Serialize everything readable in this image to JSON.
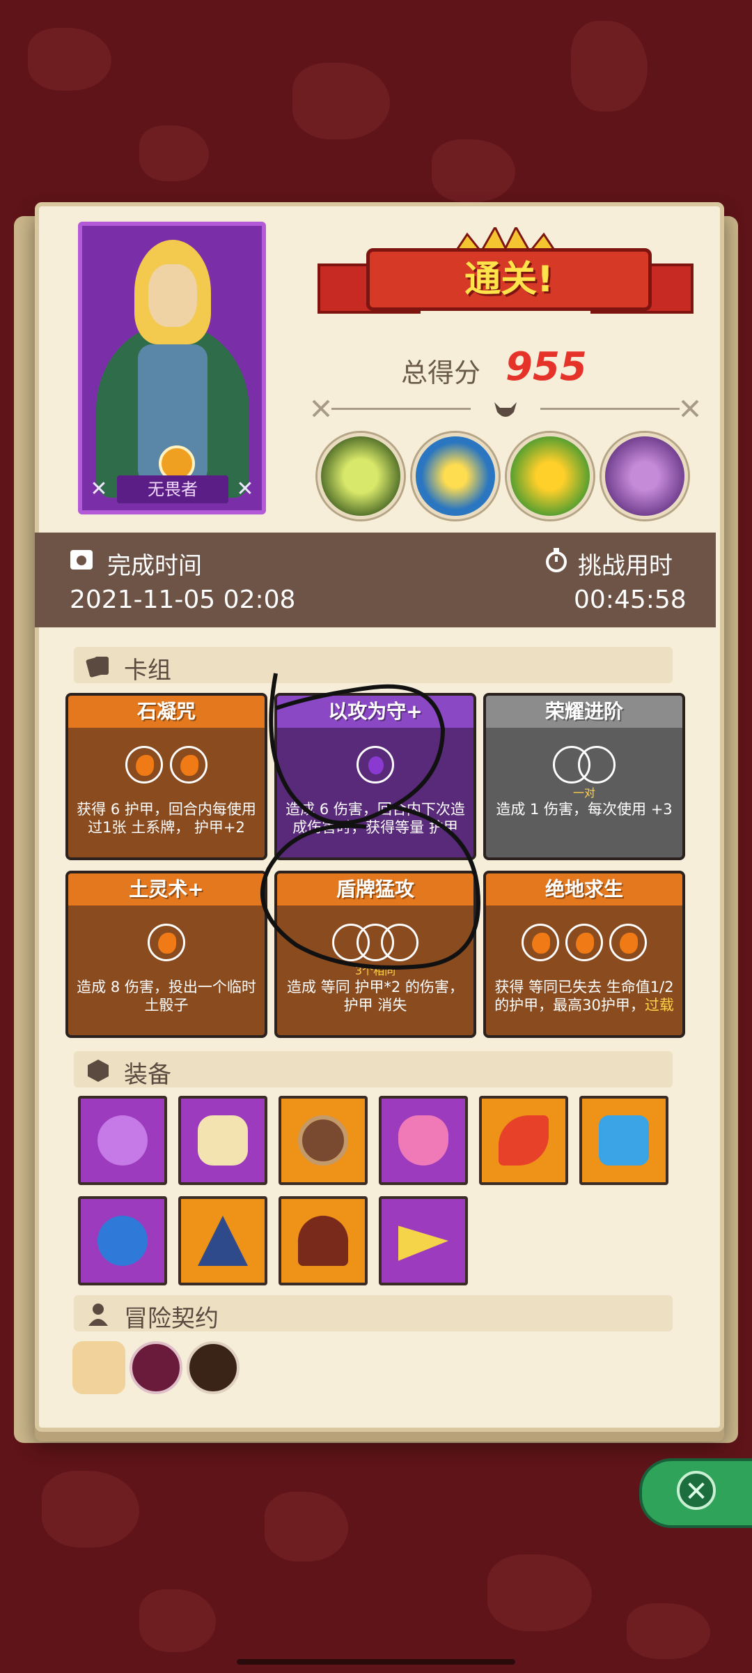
{
  "hero": {
    "name": "无畏者"
  },
  "banner": {
    "title": "通关!"
  },
  "score": {
    "label": "总得分",
    "value": "955"
  },
  "info": {
    "completion_label": "完成时间",
    "completion_value": "2021-11-05 02:08",
    "duration_label": "挑战用时",
    "duration_value": "00:45:58"
  },
  "sections": {
    "deck": "卡组",
    "equipment": "装备",
    "contract": "冒险契约"
  },
  "cards": [
    {
      "title": "石凝咒",
      "desc": "获得 6 护甲，回合内每使用过1张 土系牌， 护甲+2",
      "sub": ""
    },
    {
      "title": "以攻为守+",
      "desc": "造成 6 伤害，回合内下次造成伤害时，获得等量 护甲",
      "sub": ""
    },
    {
      "title": "荣耀进阶",
      "desc": "造成 1 伤害，每次使用 +3",
      "sub": "一对"
    },
    {
      "title": "土灵术+",
      "desc": "造成 8 伤害，投出一个临时土骰子",
      "sub": ""
    },
    {
      "title": "盾牌猛攻",
      "desc": "造成 等同 护甲*2 的伤害， 护甲 消失",
      "sub": "3个相同"
    },
    {
      "title": "绝地求生",
      "desc": "获得 等同已失去 生命值1/2 的护甲，最高30护甲，",
      "highlight": "过载",
      "sub": ""
    }
  ],
  "equipment": [
    {
      "icon": "potion-icon",
      "rarity": "purple"
    },
    {
      "icon": "claws-icon",
      "rarity": "purple"
    },
    {
      "icon": "ring-plate-icon",
      "rarity": "orange"
    },
    {
      "icon": "heart-amulet-icon",
      "rarity": "purple"
    },
    {
      "icon": "feather-icon",
      "rarity": "orange"
    },
    {
      "icon": "crystal-shield-icon",
      "rarity": "orange"
    },
    {
      "icon": "blue-flame-icon",
      "rarity": "purple"
    },
    {
      "icon": "hexagram-icon",
      "rarity": "orange"
    },
    {
      "icon": "hood-icon",
      "rarity": "orange"
    },
    {
      "icon": "cheese-icon",
      "rarity": "purple"
    }
  ],
  "contracts": [
    {
      "icon": "scroll-icon"
    },
    {
      "icon": "dice-icon"
    },
    {
      "icon": "pipe-icon"
    }
  ],
  "bosses": [
    {
      "icon": "dino-skull-icon"
    },
    {
      "icon": "crowned-beetle-icon"
    },
    {
      "icon": "goblin-king-icon"
    },
    {
      "icon": "purple-dragon-icon"
    }
  ],
  "colors": {
    "background": "#5e1418",
    "panel": "#f6eed8",
    "score": "#e6332a",
    "info_bar": "#6e5447"
  }
}
